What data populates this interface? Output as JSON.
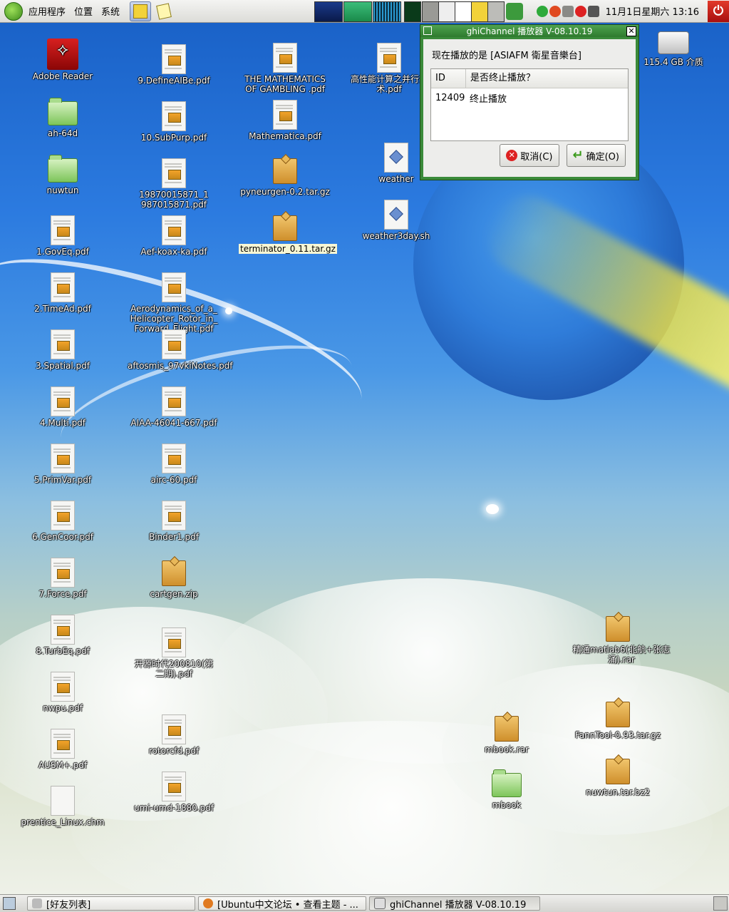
{
  "top_panel": {
    "menus": [
      "应用程序",
      "位置",
      "系统"
    ],
    "clock": "11月1日星期六 13:16"
  },
  "desktop": {
    "icons": [
      {
        "label": "Adobe Reader",
        "type": "acrobat"
      },
      {
        "label": "ah-64d",
        "type": "folder"
      },
      {
        "label": "nuwtun",
        "type": "folder"
      },
      {
        "label": "1.GovEq.pdf",
        "type": "pdf"
      },
      {
        "label": "2.TimeAd.pdf",
        "type": "pdf"
      },
      {
        "label": "3.Spatial.pdf",
        "type": "pdf"
      },
      {
        "label": "4.Multi.pdf",
        "type": "pdf"
      },
      {
        "label": "5.PrimVar.pdf",
        "type": "pdf"
      },
      {
        "label": "6.GenCoor.pdf",
        "type": "pdf"
      },
      {
        "label": "7.Force.pdf",
        "type": "pdf"
      },
      {
        "label": "8.TurbEq.pdf",
        "type": "pdf"
      },
      {
        "label": "nwpu.pdf",
        "type": "pdf"
      },
      {
        "label": "AUSM+.pdf",
        "type": "pdf"
      },
      {
        "label": "prentice_Linux.chm",
        "type": "chm"
      },
      {
        "label": "9.DefineAIBe.pdf",
        "type": "pdf"
      },
      {
        "label": "10.SubPurp.pdf",
        "type": "pdf"
      },
      {
        "label": "19870015871_1987015871.pdf",
        "type": "pdf"
      },
      {
        "label": "Aef-koax-ka.pdf",
        "type": "pdf"
      },
      {
        "label": "Aerodynamics_of_a_Helicopter_Rotor_in_Forward_Flight.pdf",
        "type": "pdf"
      },
      {
        "label": "aftosmis_97vkiNotes.pdf",
        "type": "pdf"
      },
      {
        "label": "AIAA-46041-667.pdf",
        "type": "pdf"
      },
      {
        "label": "airc-60.pdf",
        "type": "pdf"
      },
      {
        "label": "Binder1.pdf",
        "type": "pdf"
      },
      {
        "label": "cartgen.zip",
        "type": "archive"
      },
      {
        "label": "开源时代200810(第二期).pdf",
        "type": "pdf"
      },
      {
        "label": "rotorcfd.pdf",
        "type": "pdf"
      },
      {
        "label": "umi-umd-1880.pdf",
        "type": "pdf"
      },
      {
        "label": "THE MATHEMATICS OF GAMBLING .pdf",
        "type": "pdf"
      },
      {
        "label": "Mathematica.pdf",
        "type": "pdf"
      },
      {
        "label": "pyneurgen-0.2.tar.gz",
        "type": "archive"
      },
      {
        "label": "terminator_0.11.tar.gz",
        "type": "archive"
      },
      {
        "label": "高性能计算之并行技术.pdf",
        "type": "pdf"
      },
      {
        "label": "weather",
        "type": "script"
      },
      {
        "label": "weather3day.sh",
        "type": "script"
      },
      {
        "label": "115.4 GB 介质",
        "type": "drive"
      },
      {
        "label": "精通matlab6(北航+张志涌).rar",
        "type": "archive"
      },
      {
        "label": "FannTool-0.93.tar.gz",
        "type": "archive"
      },
      {
        "label": "nuwtun.tar.bz2",
        "type": "archive"
      },
      {
        "label": "mbook.rar",
        "type": "archive"
      },
      {
        "label": "mbook",
        "type": "folder"
      }
    ]
  },
  "dialog": {
    "title": "ghiChannel 播放器 V-08.10.19",
    "close_glyph": "✕",
    "now_playing": "现在播放的是 [ASIAFM 衛星音樂台]",
    "columns": [
      "ID",
      "是否终止播放？"
    ],
    "rows": [
      {
        "id": "12409",
        "action": "终止播放"
      }
    ],
    "cancel_label": "取消(C)",
    "ok_label": "确定(O)"
  },
  "taskbar": {
    "tasks": [
      {
        "label": "[好友列表]"
      },
      {
        "label": "[Ubuntu中文论坛 • 查看主题 - ..."
      },
      {
        "label": "ghiChannel 播放器 V-08.10.19"
      }
    ]
  },
  "colors": {
    "dialog_frame": "#3a8a3a",
    "power_button": "#c41a1a"
  }
}
